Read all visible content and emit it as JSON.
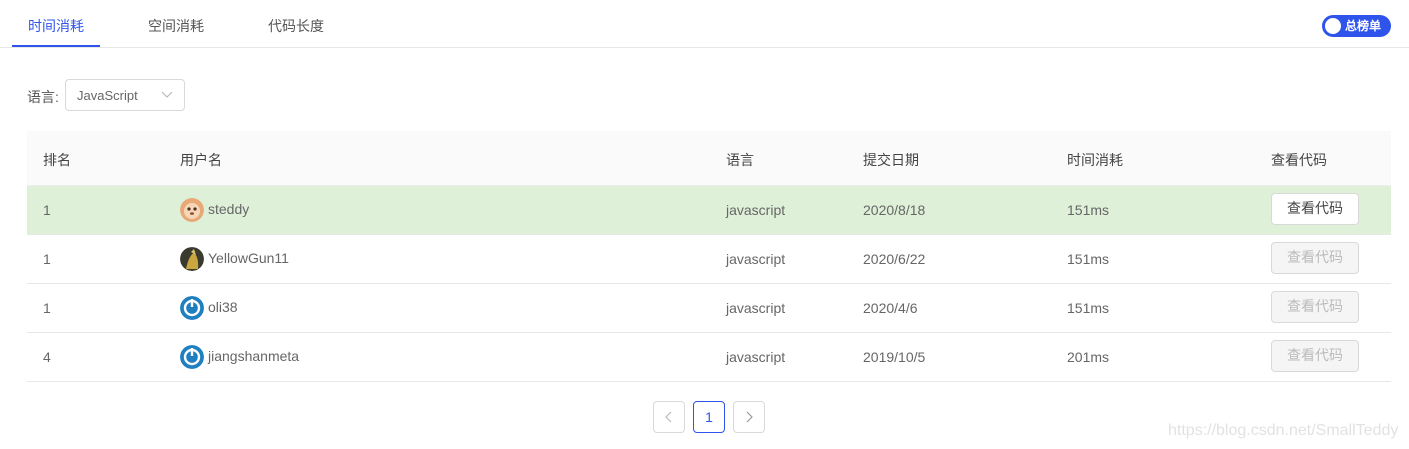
{
  "tabs": [
    {
      "label": "时间消耗",
      "active": true
    },
    {
      "label": "空间消耗",
      "active": false
    },
    {
      "label": "代码长度",
      "active": false
    }
  ],
  "toggle": {
    "label": "总榜单",
    "on": true
  },
  "filter": {
    "label": "语言:",
    "selected": "JavaScript"
  },
  "table": {
    "headers": [
      "排名",
      "用户名",
      "语言",
      "提交日期",
      "时间消耗",
      "查看代码"
    ],
    "rows": [
      {
        "rank": "1",
        "user": "steddy",
        "language": "javascript",
        "date": "2020/8/18",
        "time": "151ms",
        "action": "查看代码",
        "enabled": true,
        "highlight": true
      },
      {
        "rank": "1",
        "user": "YellowGun11",
        "language": "javascript",
        "date": "2020/6/22",
        "time": "151ms",
        "action": "查看代码",
        "enabled": false,
        "highlight": false
      },
      {
        "rank": "1",
        "user": "oli38",
        "language": "javascript",
        "date": "2020/4/6",
        "time": "151ms",
        "action": "查看代码",
        "enabled": false,
        "highlight": false
      },
      {
        "rank": "4",
        "user": "jiangshanmeta",
        "language": "javascript",
        "date": "2019/10/5",
        "time": "201ms",
        "action": "查看代码",
        "enabled": false,
        "highlight": false
      }
    ]
  },
  "pagination": {
    "current": "1"
  },
  "watermark": "https://blog.csdn.net/SmallTeddy",
  "colors": {
    "accent": "#2f54eb",
    "highlight_row": "#dff0d8"
  }
}
